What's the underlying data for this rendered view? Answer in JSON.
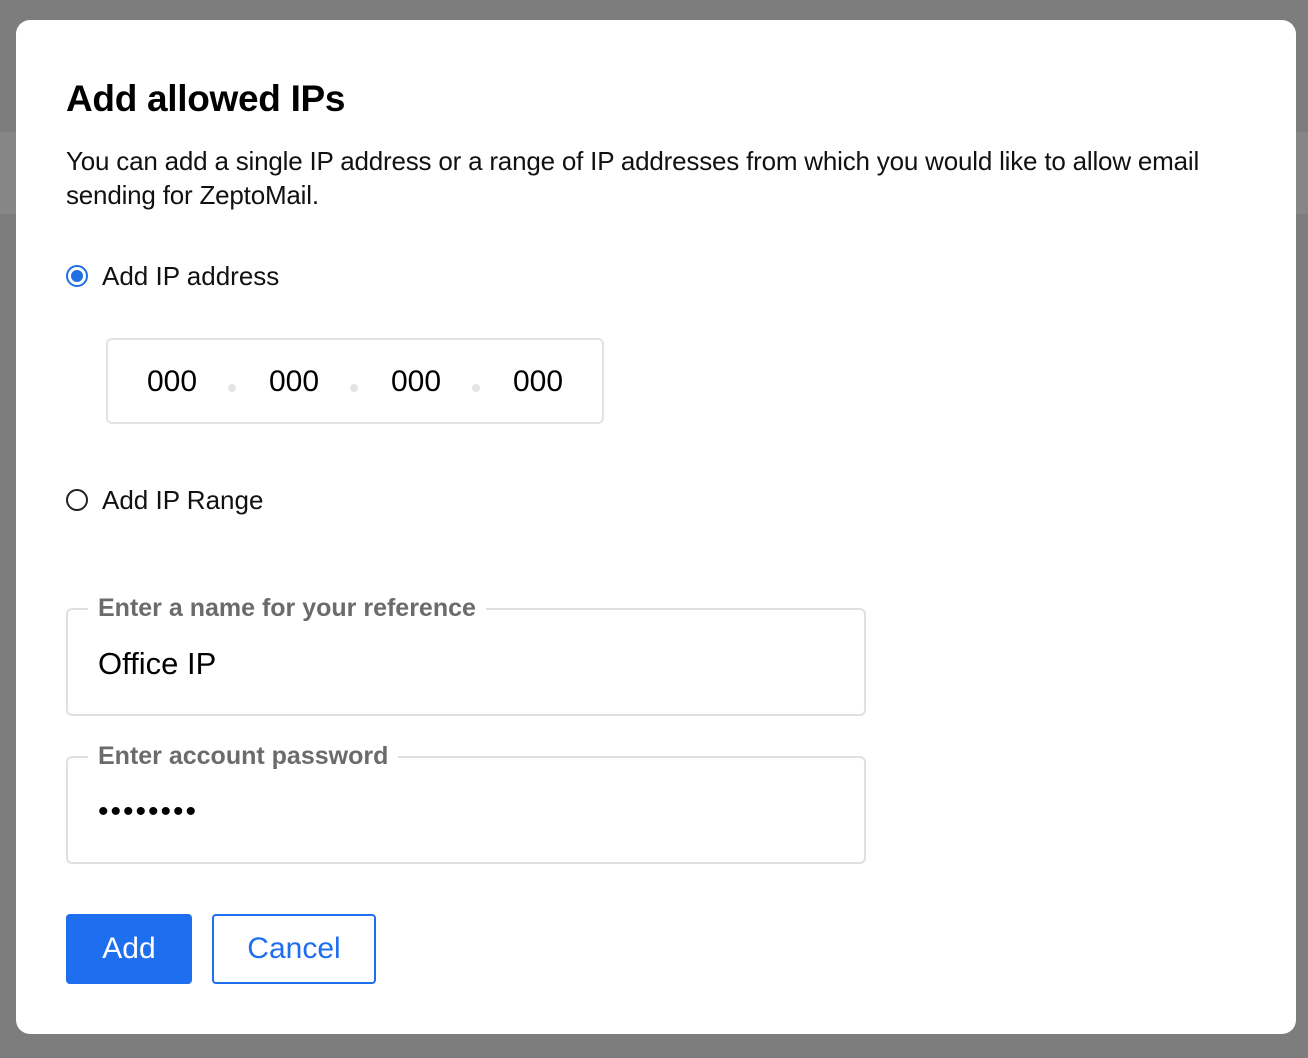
{
  "dialog": {
    "title": "Add allowed IPs",
    "description": "You can add a single IP address or a range of IP addresses from which you would like to allow email sending for ZeptoMail."
  },
  "options": {
    "ip_address": {
      "label": "Add IP address",
      "selected": true
    },
    "ip_range": {
      "label": "Add IP Range",
      "selected": false
    }
  },
  "ip_input": {
    "octets": [
      "000",
      "000",
      "000",
      "000"
    ]
  },
  "name_field": {
    "label": "Enter a name for your reference",
    "value": "Office IP"
  },
  "password_field": {
    "label": "Enter account password",
    "value": "••••••••"
  },
  "buttons": {
    "add": "Add",
    "cancel": "Cancel"
  },
  "colors": {
    "accent": "#1e6ff0",
    "backdrop": "#7d7d7d",
    "field_border": "#e0e0e0",
    "legend_text": "#6b6b6b"
  }
}
